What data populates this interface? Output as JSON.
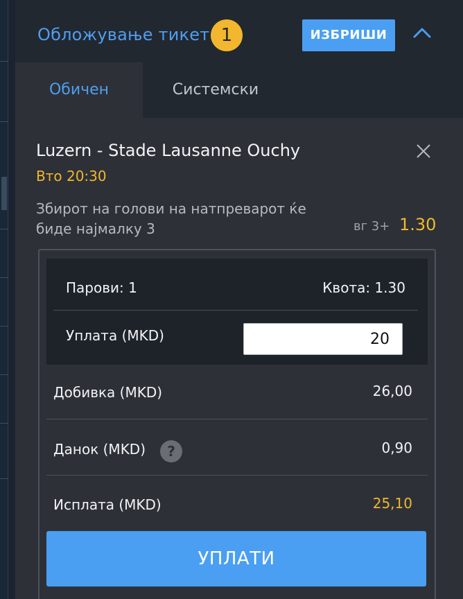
{
  "header": {
    "title": "Обложување тикет",
    "selection_count": "1",
    "clear_label": "ИЗБРИШИ"
  },
  "tabs": [
    {
      "label": "Обичен",
      "active": true
    },
    {
      "label": "Системски",
      "active": false
    }
  ],
  "selection": {
    "match": "Luzern - Stade Lausanne Ouchy",
    "kickoff": "Вто 20:30",
    "market": "Збирот на голови на натпреварот ќе биде најмалку 3",
    "pick": "вг 3+",
    "odds": "1.30"
  },
  "summary": {
    "pairs": "Парови: 1",
    "odds": "Квота: 1.30",
    "stake_label": "Уплата (MKD)",
    "stake_value": "20",
    "winnings_label": "Добивка (MKD)",
    "winnings_value": "26,00",
    "tax_label": "Данок (MKD)",
    "tax_value": "0,90",
    "payout_label": "Исплата (MKD)",
    "payout_value": "25,10"
  },
  "pay_button": "УПЛАТИ",
  "colors": {
    "accent_blue": "#4a9ff2",
    "accent_yellow": "#f2b72e",
    "panel_bg": "#2d3137",
    "header_bg": "#222830"
  },
  "icons": {
    "collapse": "chevron-up-icon",
    "remove": "close-icon",
    "help": "question-icon"
  }
}
